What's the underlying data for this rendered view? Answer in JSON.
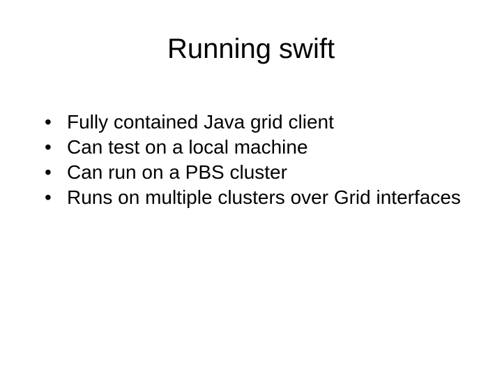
{
  "slide": {
    "title": "Running swift",
    "bullets": [
      "Fully contained Java grid client",
      "Can test on a local machine",
      "Can run on a PBS cluster",
      "Runs on multiple clusters over Grid interfaces"
    ]
  }
}
